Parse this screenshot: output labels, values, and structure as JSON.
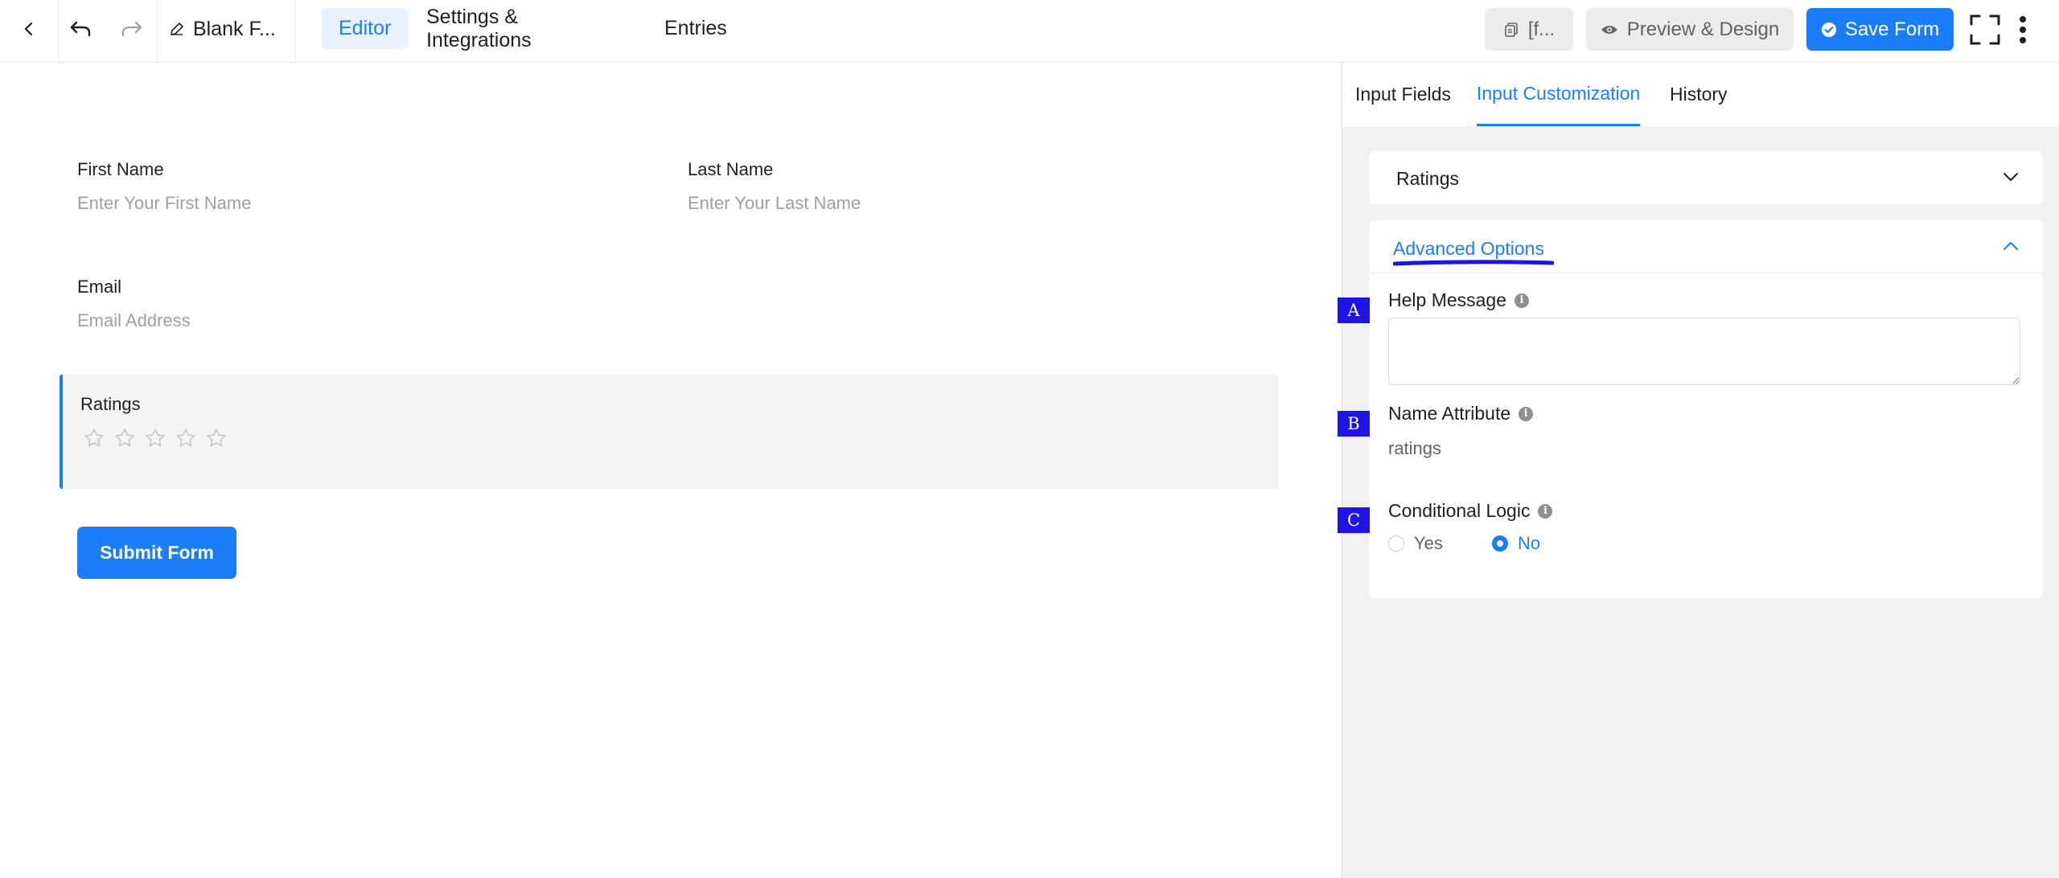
{
  "topbar": {
    "form_title": "Blank F...",
    "menu": {
      "editor": "Editor",
      "settings": "Settings & Integrations",
      "entries": "Entries"
    },
    "shortcode_label": "[f...",
    "preview_label": "Preview & Design",
    "save_label": "Save Form"
  },
  "form": {
    "first_name": {
      "label": "First Name",
      "placeholder": "Enter Your First Name"
    },
    "last_name": {
      "label": "Last Name",
      "placeholder": "Enter Your Last Name"
    },
    "email": {
      "label": "Email",
      "placeholder": "Email Address"
    },
    "ratings": {
      "label": "Ratings",
      "stars": 5,
      "selected": 0
    },
    "submit_label": "Submit Form"
  },
  "panel": {
    "tabs": {
      "input_fields": "Input Fields",
      "customization": "Input Customization",
      "history": "History"
    },
    "ratings_section": "Ratings",
    "advanced_title": "Advanced Options",
    "help_message_label": "Help Message",
    "help_message_value": "",
    "name_attribute_label": "Name Attribute",
    "name_attribute_value": "ratings",
    "conditional_logic_label": "Conditional Logic",
    "conditional_yes": "Yes",
    "conditional_no": "No",
    "conditional_selected": "No",
    "info_glyph": "i"
  },
  "badges": {
    "a": "A",
    "b": "B",
    "c": "C"
  },
  "colors": {
    "accent": "#1a7efb",
    "badge": "#1f13e6",
    "panel_bg": "#f1f1f2"
  },
  "icons": [
    "chevron-left-icon",
    "undo-icon",
    "redo-icon",
    "edit-pencil-icon",
    "copy-icon",
    "eye-icon",
    "check-circle-icon",
    "fullscreen-icon",
    "more-vertical-icon",
    "star-icon",
    "chevron-down-icon",
    "chevron-up-icon",
    "info-icon"
  ]
}
